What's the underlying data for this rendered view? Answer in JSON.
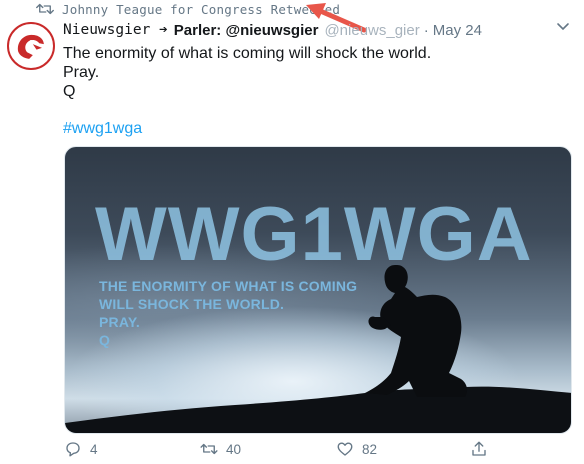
{
  "retweet": {
    "text": "Johnny Teague for Congress Retweeted",
    "icon": "retweet-icon"
  },
  "tweet": {
    "display_name": "Nieuwsgier ➔",
    "parler_label": "Parler: @nieuwsgier",
    "handle": "@nieuws_gier",
    "separator": "·",
    "date": "May 24",
    "lines": [
      "The enormity of what is coming will shock the world.",
      "Pray.",
      "Q"
    ],
    "hashtag": "#wwg1wga"
  },
  "media": {
    "headline": "WWG1WGA",
    "caption_lines": [
      "THE ENORMITY OF WHAT IS COMING",
      "WILL SHOCK THE WORLD.",
      "PRAY.",
      "Q"
    ]
  },
  "actions": {
    "reply_count": "4",
    "retweet_count": "40",
    "like_count": "82"
  },
  "colors": {
    "accent": "#1da1f2",
    "annotation_arrow": "#e8564a",
    "avatar_red": "#c92a2a"
  }
}
